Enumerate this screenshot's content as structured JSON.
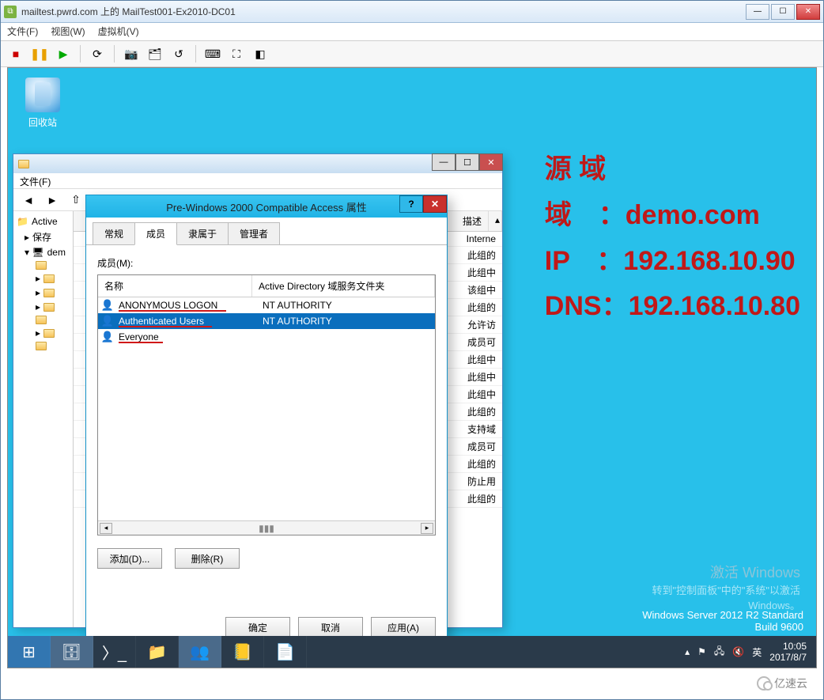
{
  "outer": {
    "title": "mailtest.pwrd.com 上的 MailTest001-Ex2010-DC01",
    "menu": {
      "file": "文件(F)",
      "view": "视图(W)",
      "vm": "虚拟机(V)"
    }
  },
  "desktop": {
    "recycle_label": "回收站"
  },
  "watermark": {
    "l1": "源 域",
    "l2": "域　：demo.com",
    "l3": "IP　：192.168.10.90",
    "l4": "DNS：192.168.10.80"
  },
  "activate": {
    "title": "激活 Windows",
    "line2": "转到\"控制面板\"中的\"系统\"以激活",
    "line3": "Windows。"
  },
  "osver": {
    "l1": "Windows Server 2012 R2 Standard",
    "l2": "Build 9600"
  },
  "taskbar": {
    "clock_time": "10:05",
    "clock_date": "2017/8/7",
    "ime": "英"
  },
  "aduc": {
    "menu_file": "文件(F)",
    "tree_root": "Active",
    "tree_saved": "保存",
    "tree_dem": "dem",
    "col_desc": "描述",
    "rows": [
      "Interne",
      "此组的",
      "此组中",
      "该组中",
      "此组的",
      "允许访",
      "成员可",
      "此组中",
      "此组中",
      "此组中",
      "此组的",
      "支持域",
      "成员可",
      "此组的",
      "防止用",
      "此组的"
    ]
  },
  "dialog": {
    "title": "Pre-Windows 2000 Compatible Access 属性",
    "tabs": {
      "general": "常规",
      "members": "成员",
      "memberof": "隶属于",
      "managed": "管理者"
    },
    "members_label": "成员(M):",
    "col_name": "名称",
    "col_dir": "Active Directory 域服务文件夹",
    "rows": [
      {
        "name": "ANONYMOUS LOGON",
        "dir": "NT AUTHORITY",
        "selected": false,
        "underline_w": 136
      },
      {
        "name": "Authenticated Users",
        "dir": "NT AUTHORITY",
        "selected": true,
        "underline_w": 118
      },
      {
        "name": "Everyone",
        "dir": "",
        "selected": false,
        "underline_w": 56
      }
    ],
    "btn_add": "添加(D)...",
    "btn_remove": "删除(R)",
    "btn_ok": "确定",
    "btn_cancel": "取消",
    "btn_apply": "应用(A)"
  },
  "yisu": "亿速云"
}
